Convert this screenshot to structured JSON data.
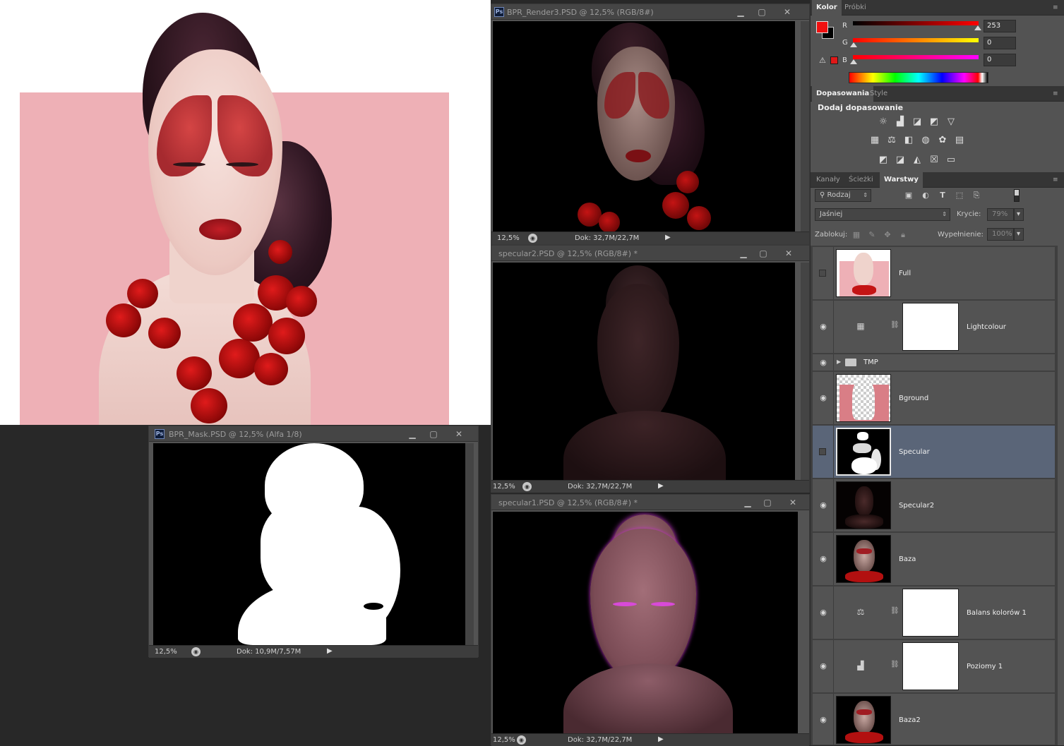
{
  "documents": {
    "bpr_render3": {
      "title": "BPR_Render3.PSD @ 12,5% (RGB/8#)",
      "zoom": "12,5%",
      "doc_size": "Dok: 32,7M/22,7M"
    },
    "specular2": {
      "title": "specular2.PSD @ 12,5% (RGB/8#) *",
      "zoom": "12,5%",
      "doc_size": "Dok: 32,7M/22,7M"
    },
    "specular1": {
      "title": "specular1.PSD @ 12,5% (RGB/8#) *",
      "zoom": "12,5%",
      "doc_size": "Dok: 32,7M/22,7M"
    },
    "bpr_mask": {
      "title": "BPR_Mask.PSD @ 12,5% (Alfa 1/8)",
      "zoom": "12,5%",
      "doc_size": "Dok: 10,9M/7,57M"
    }
  },
  "color_panel": {
    "tabs": [
      "Kolor",
      "Próbki"
    ],
    "foreground_color": "#f01010",
    "background_color": "#000000",
    "channels": [
      {
        "label": "R",
        "value": "253"
      },
      {
        "label": "G",
        "value": "0"
      },
      {
        "label": "B",
        "value": "0"
      }
    ],
    "warning_icon": "gamut-warning-icon"
  },
  "adjustments_panel": {
    "tabs": [
      "Dopasowania",
      "Style"
    ],
    "heading": "Dodaj dopasowanie",
    "icon_rows": [
      [
        "brightness-icon",
        "levels-icon",
        "curves-icon",
        "exposure-icon",
        "vibrance-icon"
      ],
      [
        "hue-saturation-icon",
        "color-balance-icon",
        "black-white-icon",
        "photo-filter-icon",
        "channel-mixer-icon",
        "color-lookup-icon"
      ],
      [
        "invert-icon",
        "posterize-icon",
        "threshold-icon",
        "selective-color-icon",
        "gradient-map-icon"
      ]
    ]
  },
  "layers_panel": {
    "tabs": [
      "Kanały",
      "Ścieżki",
      "Warstwy"
    ],
    "filter_kind": "Rodzaj",
    "blend_mode": "Jaśniej",
    "opacity_label": "Krycie:",
    "opacity_value": "79%",
    "lock_label": "Zablokuj:",
    "fill_label": "Wypełnienie:",
    "fill_value": "100%",
    "layers": [
      {
        "name": "Full",
        "visible": false,
        "type": "image",
        "selected": false
      },
      {
        "name": "Lightcolour",
        "visible": true,
        "type": "adjustment",
        "glyph": "▦",
        "selected": false
      },
      {
        "name": "TMP",
        "visible": true,
        "type": "group",
        "selected": false
      },
      {
        "name": "Bground",
        "visible": true,
        "type": "image",
        "selected": false
      },
      {
        "name": "Specular",
        "visible": false,
        "type": "image",
        "selected": true
      },
      {
        "name": "Specular2",
        "visible": true,
        "type": "image",
        "selected": false
      },
      {
        "name": "Baza",
        "visible": true,
        "type": "image",
        "selected": false
      },
      {
        "name": "Balans kolorów 1",
        "visible": true,
        "type": "adjustment",
        "glyph": "⚖",
        "selected": false
      },
      {
        "name": "Poziomy 1",
        "visible": true,
        "type": "adjustment",
        "glyph": "▟",
        "selected": false
      },
      {
        "name": "Baza2",
        "visible": true,
        "type": "image",
        "selected": false
      }
    ]
  }
}
